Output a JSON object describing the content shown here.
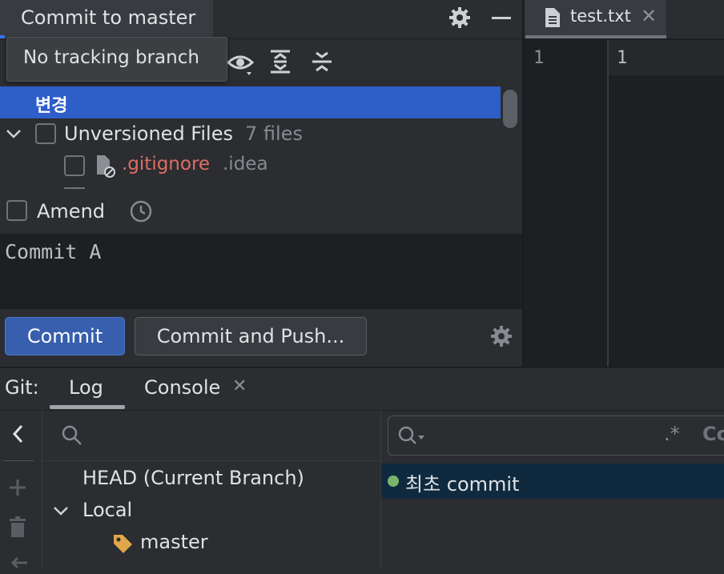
{
  "commit_panel": {
    "title": "Commit to master",
    "tooltip": "No tracking branch",
    "changes_group": "변경",
    "unversioned_label": "Unversioned Files",
    "unversioned_count": "7 files",
    "gitignore_name": ".gitignore",
    "gitignore_dir": ".idea",
    "amend_label": "Amend",
    "commit_message": "Commit A",
    "commit_button": "Commit",
    "commit_push_button": "Commit and Push..."
  },
  "editor": {
    "tab_name": "test.txt",
    "tab_close": "✕",
    "left_line_number": "1",
    "right_line_number": "1"
  },
  "git_panel": {
    "label": "Git:",
    "tabs": [
      {
        "label": "Log",
        "active": true
      },
      {
        "label": "Console",
        "close": "✕"
      }
    ],
    "branches": {
      "head": "HEAD (Current Branch)",
      "local": "Local",
      "master": "master"
    },
    "log": {
      "regex_toggle": ".*",
      "case_toggle": "Cc",
      "commit_message": "최초 commit"
    }
  },
  "colors": {
    "accent": "#3574f0",
    "selection": "#2e5ec8",
    "unversioned_file": "#e06c64",
    "commit_dot": "#7ab66a",
    "tag": "#e0a64b"
  }
}
